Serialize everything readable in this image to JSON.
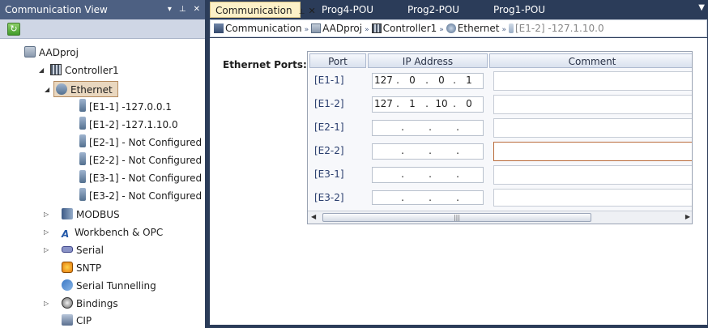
{
  "left_panel": {
    "title": "Communication View",
    "title_controls": [
      "▾",
      "⊥",
      "✕"
    ],
    "tree": {
      "project": "AADproj",
      "controller": "Controller1",
      "ethernet": "Ethernet",
      "ports": [
        "[E1-1] -127.0.0.1",
        "[E1-2] -127.1.10.0",
        "[E2-1] - Not Configured",
        "[E2-2] - Not Configured",
        "[E3-1] - Not Configured",
        "[E3-2] - Not Configured"
      ],
      "items": [
        "MODBUS",
        "Workbench & OPC",
        "Serial",
        "SNTP",
        "Serial Tunnelling",
        "Bindings",
        "CIP"
      ]
    }
  },
  "tabs": [
    {
      "label": "Communication",
      "active": true
    },
    {
      "label": "Prog4-POU"
    },
    {
      "label": "Prog2-POU"
    },
    {
      "label": "Prog1-POU"
    }
  ],
  "breadcrumb": [
    "Communication",
    "AADproj",
    "Controller1",
    "Ethernet",
    "[E1-2] -127.1.10.0"
  ],
  "ethernet_ports": {
    "label": "Ethernet Ports:",
    "columns": [
      "Port",
      "IP Address",
      "Comment"
    ],
    "rows": [
      {
        "port": "[E1-1]",
        "ip": [
          "127",
          "0",
          "0",
          "1"
        ]
      },
      {
        "port": "[E1-2]",
        "ip": [
          "127",
          "1",
          "10",
          "0"
        ]
      },
      {
        "port": "[E2-1]",
        "ip": [
          "",
          "",
          "",
          ""
        ]
      },
      {
        "port": "[E2-2]",
        "ip": [
          "",
          "",
          "",
          ""
        ]
      },
      {
        "port": "[E3-1]",
        "ip": [
          "",
          "",
          "",
          ""
        ]
      },
      {
        "port": "[E3-2]",
        "ip": [
          "",
          "",
          "",
          ""
        ]
      }
    ]
  },
  "colors": {
    "accent_tab": "#fdf1c8",
    "panel_title": "#4d6082",
    "background": "#2b3c59"
  }
}
